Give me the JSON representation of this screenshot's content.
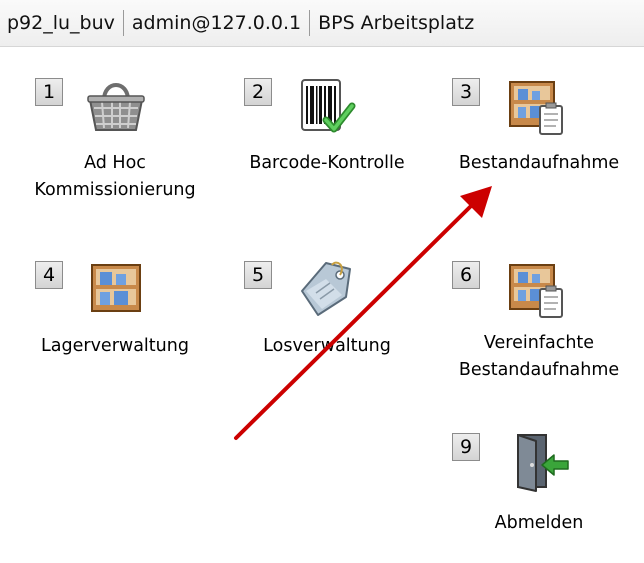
{
  "header": {
    "user": "p92_lu_buv",
    "connection": "admin@127.0.0.1",
    "title": "BPS Arbeitsplatz"
  },
  "menu": [
    {
      "key": "1",
      "label": "Ad Hoc\nKommissionierung",
      "icon": "shopping-basket-icon"
    },
    {
      "key": "2",
      "label": "Barcode-Kontrolle",
      "icon": "barcode-check-icon"
    },
    {
      "key": "3",
      "label": "Bestandaufnahme",
      "icon": "shelf-clipboard-icon"
    },
    {
      "key": "4",
      "label": "Lagerverwaltung",
      "icon": "shelf-icon"
    },
    {
      "key": "5",
      "label": "Losverwaltung",
      "icon": "tag-icon"
    },
    {
      "key": "6",
      "label": "Vereinfachte\nBestandaufnahme",
      "icon": "shelf-clipboard-icon"
    },
    {
      "key": "9",
      "label": "Abmelden",
      "icon": "exit-door-icon"
    }
  ],
  "colors": {
    "annotation_arrow": "#cc0000",
    "check_green": "#3aa53a"
  }
}
